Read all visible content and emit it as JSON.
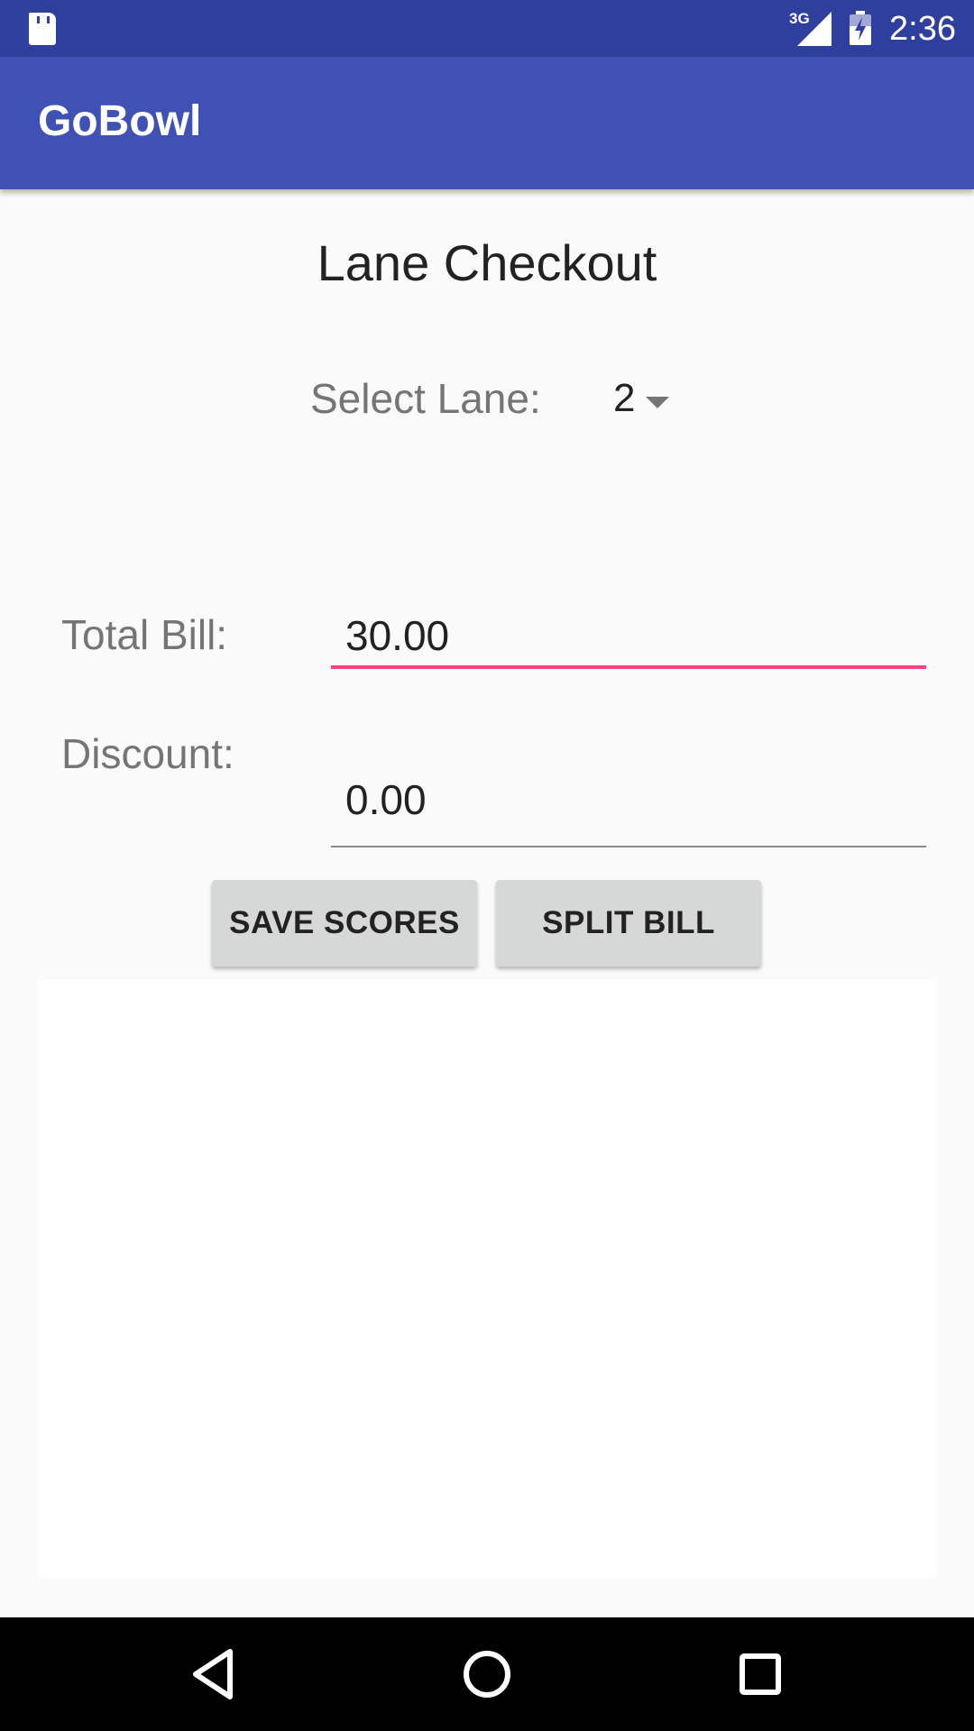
{
  "status_bar": {
    "network": "3G",
    "time": "2:36",
    "icons": [
      "sd-card-icon",
      "signal-icon",
      "battery-charging-icon"
    ]
  },
  "app_bar": {
    "title": "GoBowl"
  },
  "checkout": {
    "heading": "Lane Checkout",
    "lane_label": "Select Lane:",
    "lane_value": "2",
    "total_label": "Total Bill:",
    "total_value": "30.00",
    "discount_label": "Discount:",
    "discount_value": "0.00"
  },
  "buttons": {
    "save_scores": "SAVE SCORES",
    "split_bill": "SPLIT BILL"
  },
  "navigation": {
    "icons": [
      "back-icon",
      "home-icon",
      "recents-icon"
    ]
  },
  "colors": {
    "status_bar": "#2f3f9e",
    "app_bar": "#3f51b5",
    "accent": "#ff4081",
    "background": "#fafafa",
    "button": "#d6d7d7"
  }
}
